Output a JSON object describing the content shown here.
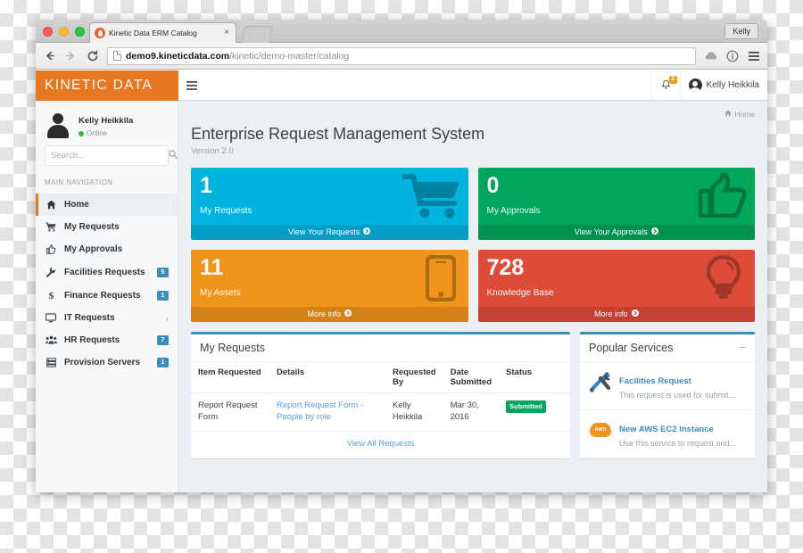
{
  "browser": {
    "tab_title": "Kinetic Data ERM Catalog",
    "tab_close": "×",
    "favicon_name": "kinetic-data-favicon",
    "profile_label": "Kelly",
    "url_host": "demo9.kineticdata.com",
    "url_path": "/kinetic/demo-master/catalog",
    "back_icon": "back-arrow-icon",
    "forward_icon": "forward-arrow-icon",
    "reload_icon": "reload-icon",
    "bookmark_icon": "cloud-icon",
    "info_icon": "info-circle-icon",
    "menu_icon": "hamburger-menu-icon"
  },
  "header": {
    "brand": "KINETIC DATA",
    "brand_color": "#e87722",
    "toggle_icon": "hamburger-menu-icon",
    "notifications": {
      "icon": "bell-icon",
      "count": "2",
      "badge_color": "#f39c12"
    },
    "user": {
      "name": "Kelly Heikkila",
      "avatar_icon": "user-avatar-icon"
    }
  },
  "sidebar": {
    "user": {
      "name": "Kelly Heikkila",
      "status": "Online",
      "status_color": "#33bb33"
    },
    "search": {
      "value": "",
      "placeholder": "Search...",
      "icon": "search-icon"
    },
    "nav_header": "MAIN NAVIGATION",
    "items": [
      {
        "label": "Home",
        "icon": "home-icon",
        "active": true,
        "badge": "",
        "chevron": ""
      },
      {
        "label": "My Requests",
        "icon": "shopping-cart-icon",
        "active": false,
        "badge": "",
        "chevron": ""
      },
      {
        "label": "My Approvals",
        "icon": "thumbs-up-icon",
        "active": false,
        "badge": "",
        "chevron": ""
      },
      {
        "label": "Facilities Requests",
        "icon": "wrench-icon",
        "active": false,
        "badge": "5",
        "chevron": ""
      },
      {
        "label": "Finance Requests",
        "icon": "dollar-sign-icon",
        "active": false,
        "badge": "1",
        "chevron": ""
      },
      {
        "label": "IT Requests",
        "icon": "desktop-icon",
        "active": false,
        "badge": "",
        "chevron": "‹"
      },
      {
        "label": "HR Requests",
        "icon": "users-group-icon",
        "active": false,
        "badge": "7",
        "chevron": ""
      },
      {
        "label": "Provision Servers",
        "icon": "server-icon",
        "active": false,
        "badge": "1",
        "chevron": ""
      }
    ],
    "badge_color": "#3c8dbc"
  },
  "content": {
    "breadcrumb": {
      "icon": "home-icon",
      "label": "Home"
    },
    "page_title": "Enterprise Request Management System",
    "page_subtitle": "Version 2.0",
    "cards": [
      {
        "number": "1",
        "label": "My Requests",
        "footer": "View Your Requests",
        "color": "#00b4e0",
        "art": "shopping-cart-icon"
      },
      {
        "number": "0",
        "label": "My Approvals",
        "footer": "View Your Approvals",
        "color": "#00a65a",
        "art": "thumbs-up-icon"
      },
      {
        "number": "11",
        "label": "My Assets",
        "footer": "More info",
        "color": "#f0951b",
        "art": "mobile-phone-icon"
      },
      {
        "number": "728",
        "label": "Knowledge Base",
        "footer": "More info",
        "color": "#dd4b39",
        "art": "lightbulb-icon"
      }
    ],
    "requests_panel": {
      "title": "My Requests",
      "columns": [
        "Item Requested",
        "Details",
        "Requested By",
        "Date Submitted",
        "Status"
      ],
      "rows": [
        {
          "item": "Report Request Form",
          "details": "Report Request Form - People by role",
          "requested_by": "Kelly Heikkila",
          "date": "Mar 30, 2016",
          "status": "Submitted",
          "status_color": "#00a65a"
        }
      ],
      "footer_link": "View All Requests"
    },
    "popular_panel": {
      "title": "Popular Services",
      "collapse_icon": "minus-icon",
      "items": [
        {
          "title": "Facilities Request",
          "desc": "This request is used for submit...",
          "icon": "tools-icon"
        },
        {
          "title": "New AWS EC2 Instance",
          "desc": "Use this service to request and...",
          "icon": "aws-cloud-icon",
          "icon_label": "AWS"
        }
      ]
    }
  }
}
